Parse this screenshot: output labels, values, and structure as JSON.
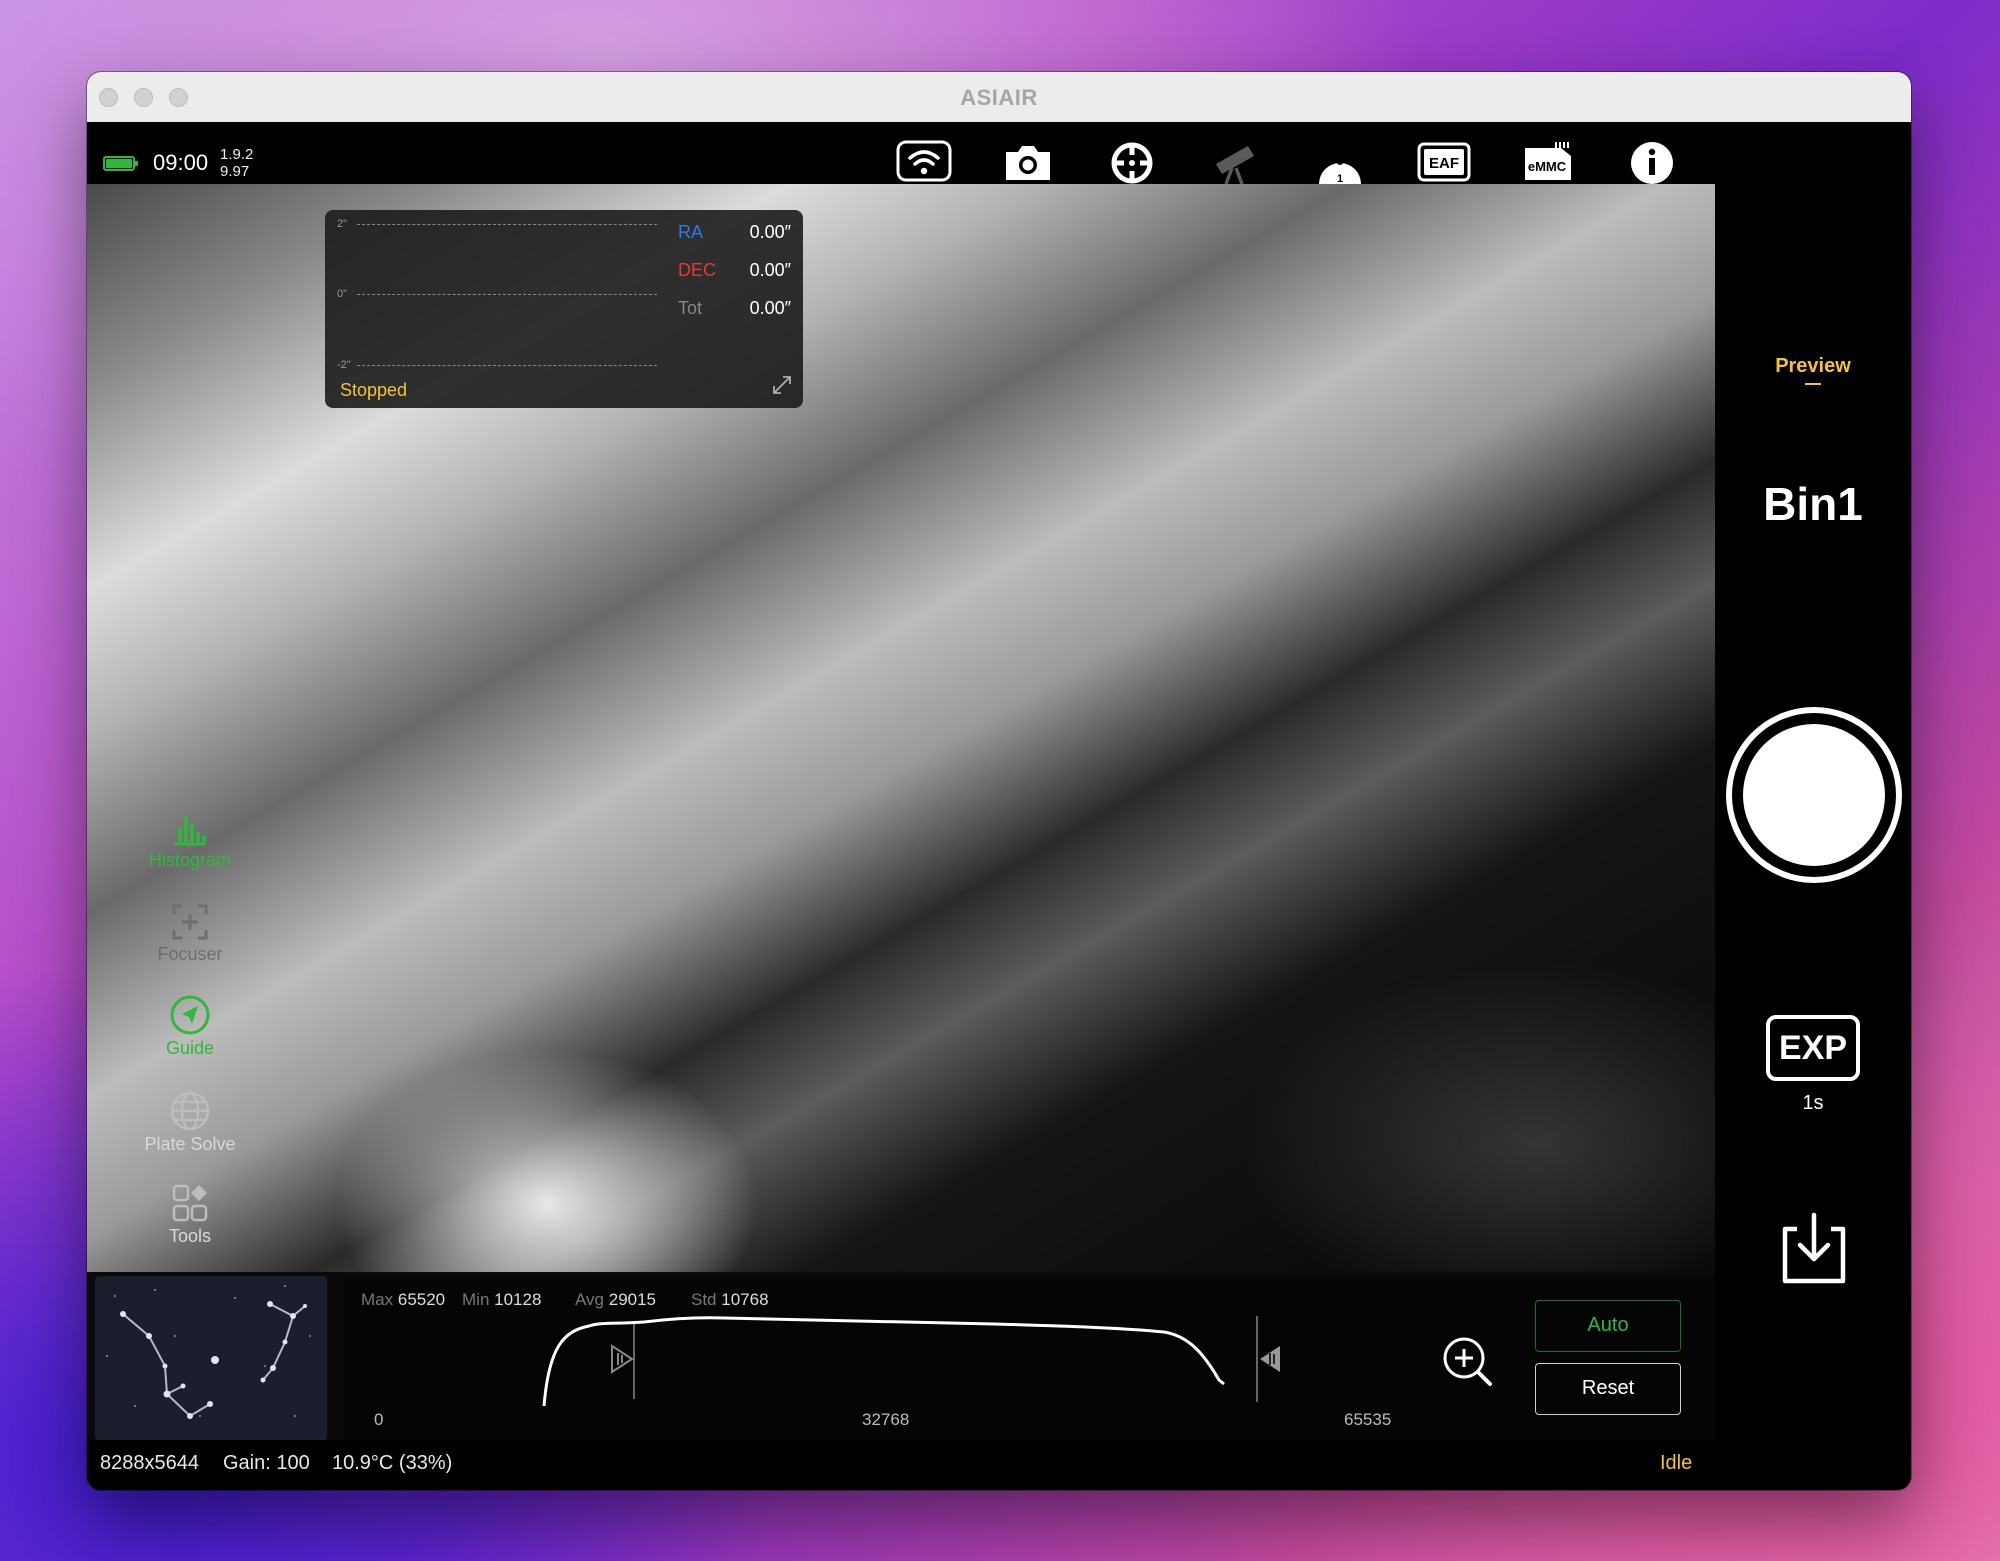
{
  "window": {
    "title": "ASIAIR"
  },
  "topbar": {
    "time": "09:00",
    "version": "1.9.2",
    "voltage": "9.97",
    "icons": [
      "wifi-icon",
      "camera-icon",
      "guide-scope-icon",
      "telescope-icon",
      "filter-wheel-icon",
      "eaf-icon",
      "emmc-icon",
      "info-icon"
    ],
    "filter_wheel_slot": "1",
    "eaf_label": "EAF",
    "emmc_label": "eMMC"
  },
  "guide_graph": {
    "axis_top": "2\"",
    "axis_mid": "0\"",
    "axis_bottom": "-2\"",
    "ra_label": "RA",
    "ra_value": "0.00″",
    "dec_label": "DEC",
    "dec_value": "0.00″",
    "tot_label": "Tot",
    "tot_value": "0.00″",
    "status": "Stopped"
  },
  "sidebar": {
    "items": [
      {
        "label": "Histogram",
        "icon": "histogram-icon"
      },
      {
        "label": "Focuser",
        "icon": "focuser-icon"
      },
      {
        "label": "Guide",
        "icon": "guide-icon"
      },
      {
        "label": "Plate Solve",
        "icon": "plate-solve-icon"
      },
      {
        "label": "Tools",
        "icon": "tools-icon"
      }
    ]
  },
  "histogram": {
    "max_label": "Max",
    "max_value": "65520",
    "min_label": "Min",
    "min_value": "10128",
    "avg_label": "Avg",
    "avg_value": "29015",
    "std_label": "Std",
    "std_value": "10768",
    "tick_min": "0",
    "tick_mid": "32768",
    "tick_max": "65535",
    "auto_label": "Auto",
    "reset_label": "Reset"
  },
  "status_bar": {
    "resolution": "8288x5644",
    "gain": "Gain: 100",
    "temperature": "10.9°C (33%)",
    "state": "Idle"
  },
  "right_panel": {
    "mode": "Preview",
    "bin": "Bin1",
    "exp_label": "EXP",
    "exposure": "1s"
  },
  "colors": {
    "accent_green": "#2fb93a",
    "accent_yellow": "#f4c430",
    "ra_blue": "#2b7de9",
    "dec_red": "#e53935"
  }
}
